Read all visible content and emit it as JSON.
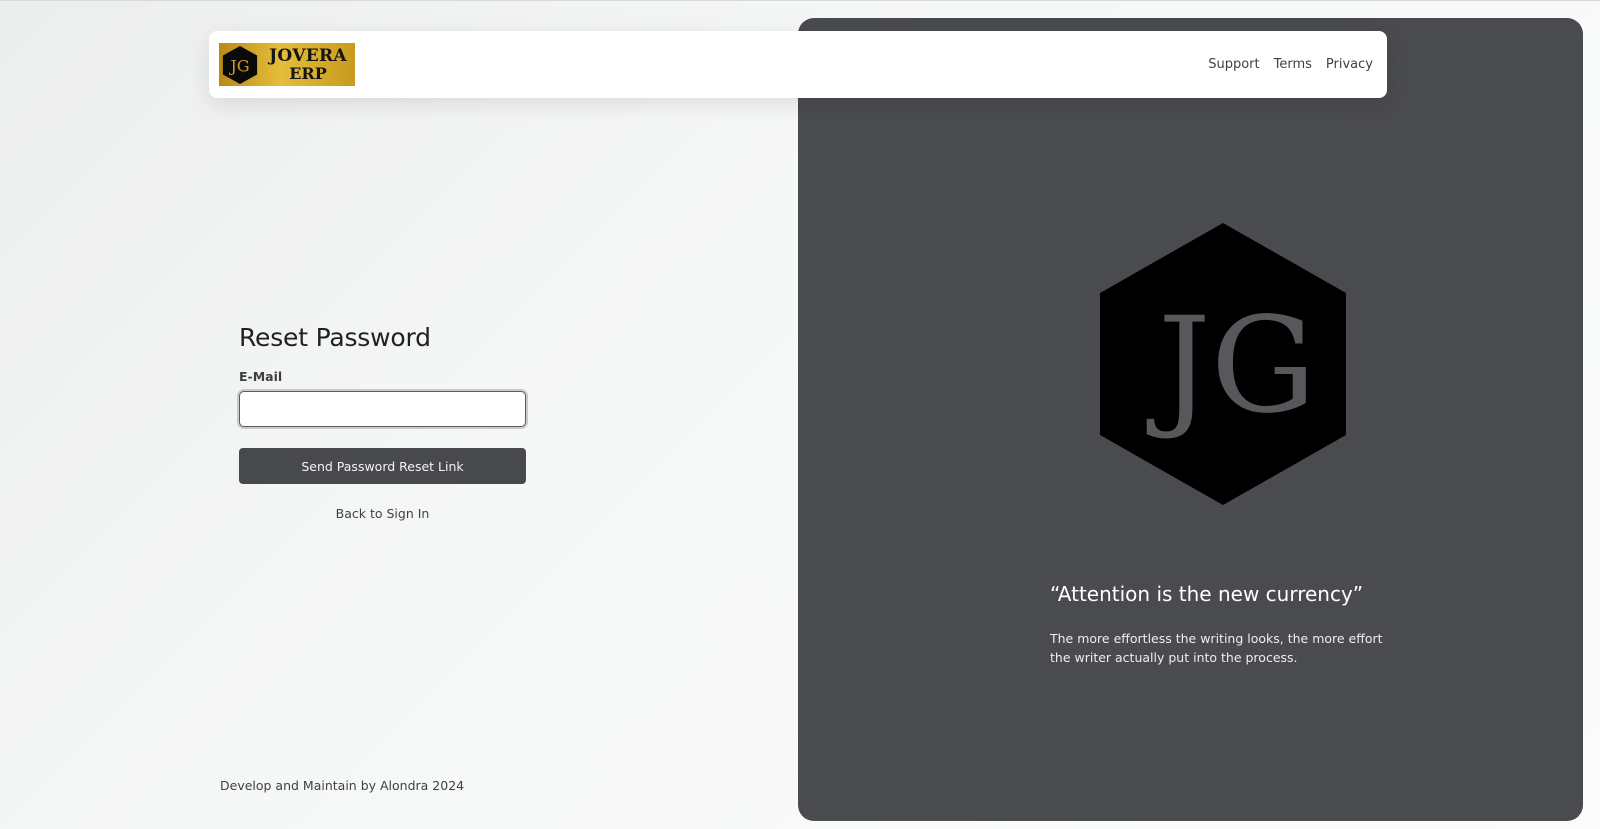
{
  "header": {
    "logo": {
      "line1": "JOVERA",
      "line2": "ERP",
      "mark": "JG"
    },
    "nav": [
      "Support",
      "Terms",
      "Privacy"
    ]
  },
  "form": {
    "title": "Reset Password",
    "email_label": "E-Mail",
    "email_value": "",
    "email_placeholder": "",
    "submit_label": "Send Password Reset Link",
    "back_link": "Back to Sign In"
  },
  "footer": {
    "text": "Develop and Maintain by Alondra 2024"
  },
  "panel": {
    "mark": "JG",
    "quote": "“Attention is the new currency”",
    "quote_sub": "The more effortless the writing looks, the more effort the writer actually put into the process."
  },
  "colors": {
    "panel_bg": "#4a4b4e",
    "button_bg": "#48494c",
    "logo_gold": "#e4be3b",
    "hexagon": "#000000",
    "monogram": "#56585c"
  }
}
